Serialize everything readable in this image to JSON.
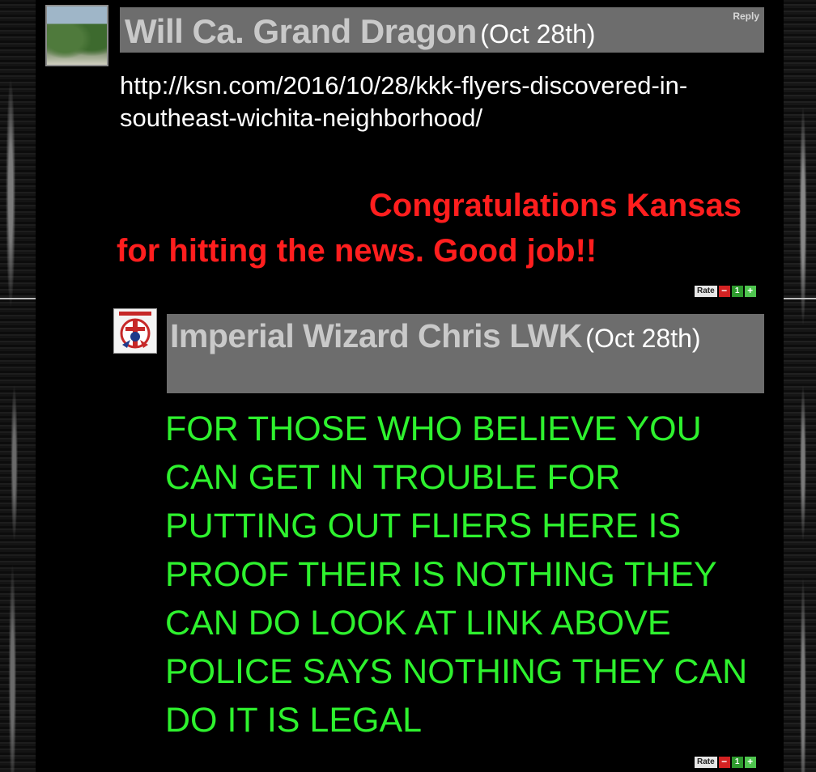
{
  "comments": [
    {
      "username": "Will Ca. Grand Dragon",
      "date": "(Oct 28th)",
      "reply_label": "Reply",
      "link_text": "http://ksn.com/2016/10/28/kkk-flyers-discovered-in-southeast-wichita-neighborhood/",
      "message_line1": "Congratulations Kansas",
      "message_line2": "for hitting the news. Good job!!",
      "message_color": "#ff1e1e",
      "rate": {
        "label": "Rate",
        "score": "1"
      }
    },
    {
      "username": "Imperial Wizard Chris LWK",
      "date": "(Oct 28th)",
      "message": "FOR THOSE WHO BELIEVE YOU CAN GET IN TROUBLE FOR PUTTING OUT FLIERS HERE IS PROOF THEIR IS NOTHING THEY CAN DO LOOK AT LINK ABOVE POLICE SAYS NOTHING THEY CAN DO IT IS LEGAL",
      "message_color": "#2ef22e",
      "rate": {
        "label": "Rate",
        "score": "1"
      }
    }
  ],
  "icons": {
    "rate_down": "thumbs-down-icon",
    "rate_up": "thumbs-up-icon"
  },
  "colors": {
    "header_bg": "#6d6d6d",
    "username": "#c9c9c9",
    "background": "#000000"
  }
}
